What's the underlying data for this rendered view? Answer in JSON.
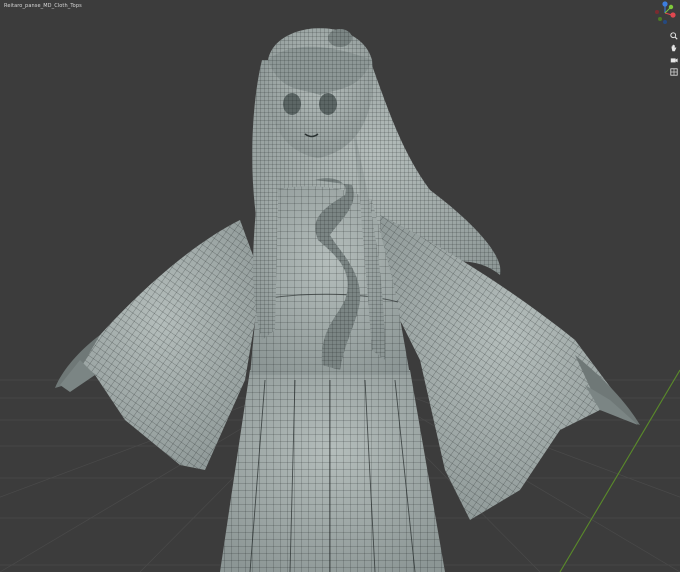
{
  "viewport": {
    "object_name": "Reitaro_panse_MD_Cloth_Tops",
    "background": "#3c3c3c",
    "grid_line_color": "#4a4a4a",
    "x_axis_color": "#5a8a2a",
    "model_fill": "#9ea8a7",
    "wire_color": "#1c2222"
  },
  "gizmo": {
    "x_color": "#e0474f",
    "y_color": "#7ec83b",
    "z_color": "#3d7ee0",
    "neg_color": "#5a5a5a"
  },
  "tools": [
    {
      "name": "zoom",
      "icon": "zoom-icon"
    },
    {
      "name": "pan",
      "icon": "pan-hand-icon"
    },
    {
      "name": "camera",
      "icon": "camera-icon"
    },
    {
      "name": "perspective",
      "icon": "grid-icon"
    }
  ]
}
